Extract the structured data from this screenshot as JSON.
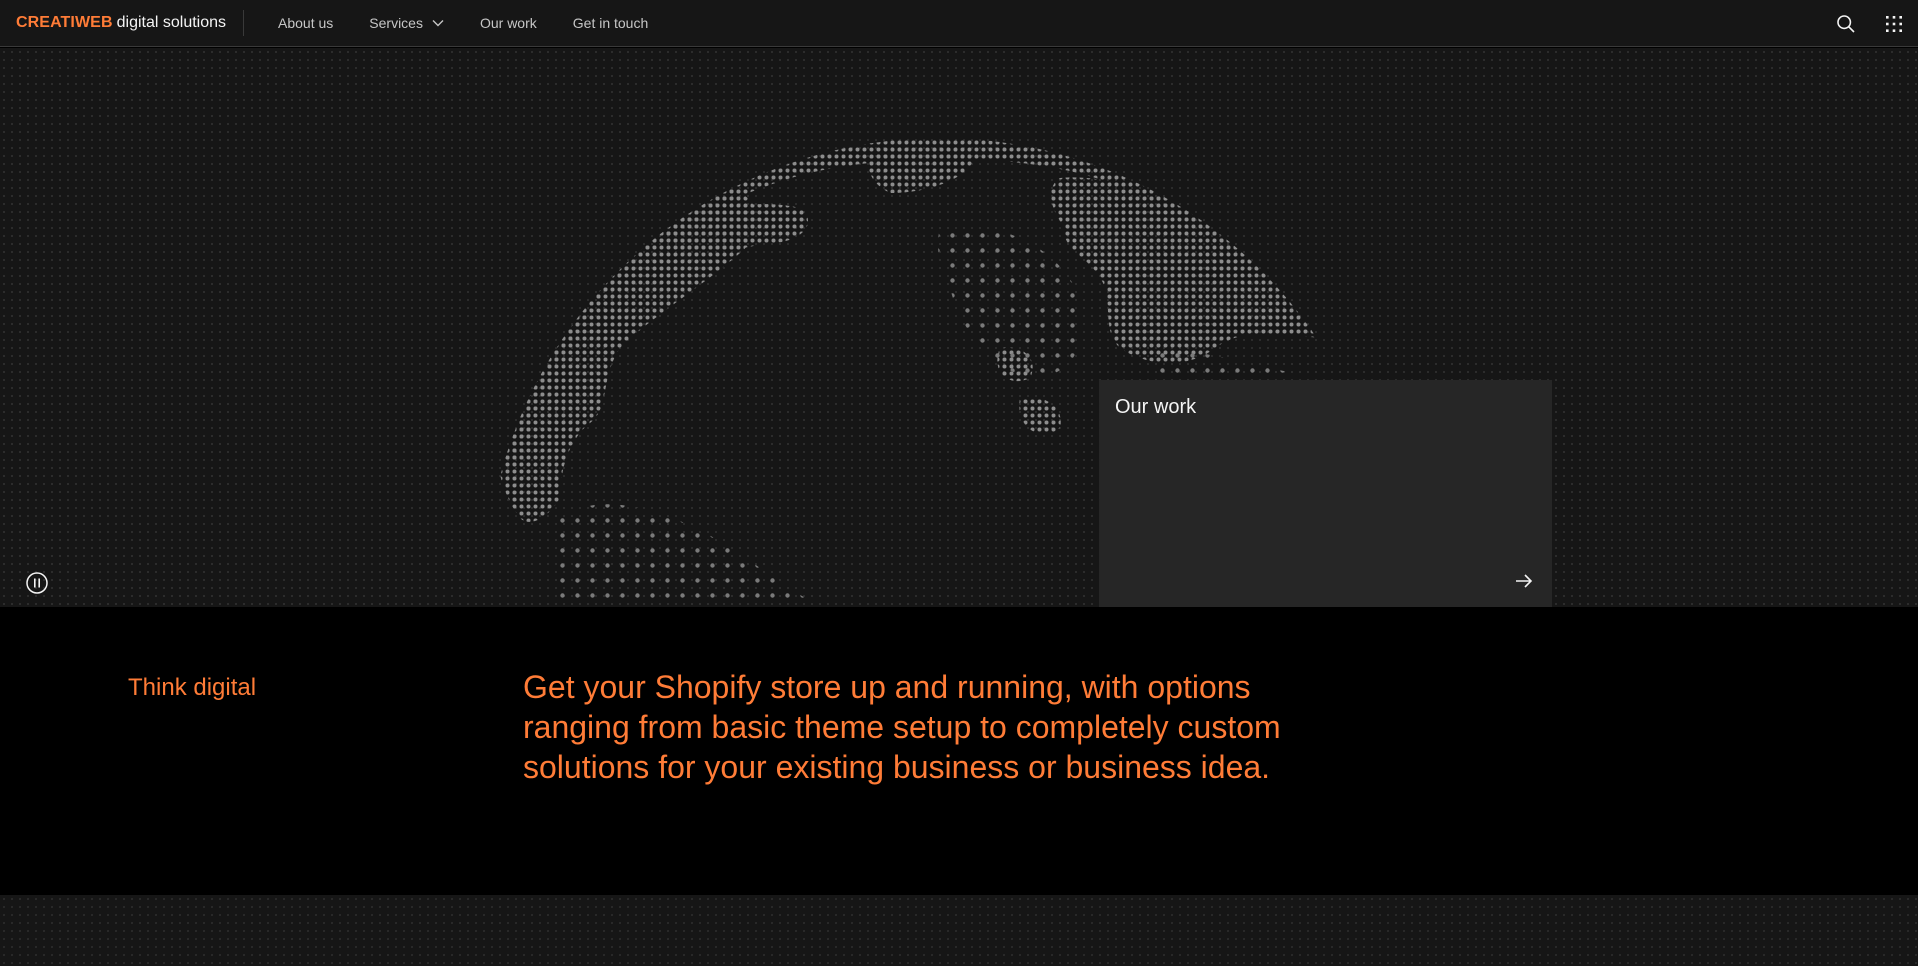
{
  "brand": {
    "strong": "CREATIWEB",
    "rest": "digital solutions"
  },
  "nav": {
    "items": [
      {
        "label": "About us"
      },
      {
        "label": "Services",
        "has_dropdown": true
      },
      {
        "label": "Our work"
      },
      {
        "label": "Get in touch"
      }
    ]
  },
  "header_actions": {
    "search_icon": "search-icon",
    "apps_icon": "app-switcher-icon"
  },
  "hero": {
    "pause_icon": "pause-icon",
    "card": {
      "title": "Our work",
      "arrow_icon": "arrow-right-icon"
    }
  },
  "intro": {
    "label": "Think digital",
    "text": "Get your Shopify store up and running, with options ranging from basic theme setup to completely custom solutions for your existing business or business idea."
  },
  "colors": {
    "accent": "#ff7c37",
    "header_bg": "#161616",
    "card_bg": "#262626",
    "page_bg": "#000000"
  }
}
